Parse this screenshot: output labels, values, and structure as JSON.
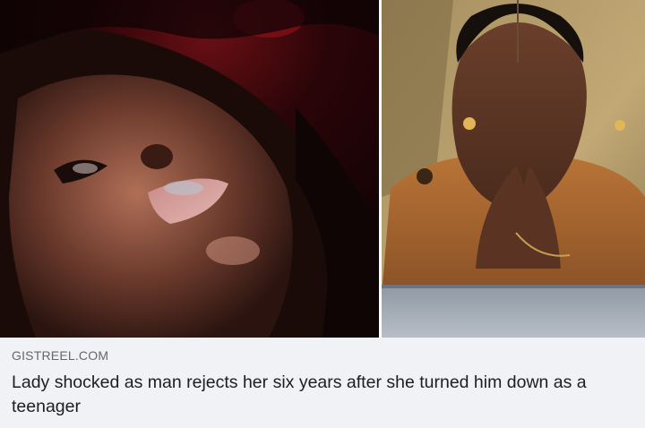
{
  "link_preview": {
    "source": "GISTREEL.COM",
    "headline": "Lady shocked as man rejects her six years after she turned him down as a teenager",
    "images": [
      {
        "name": "selfie-photo"
      },
      {
        "name": "distressed-woman-photo"
      }
    ]
  }
}
